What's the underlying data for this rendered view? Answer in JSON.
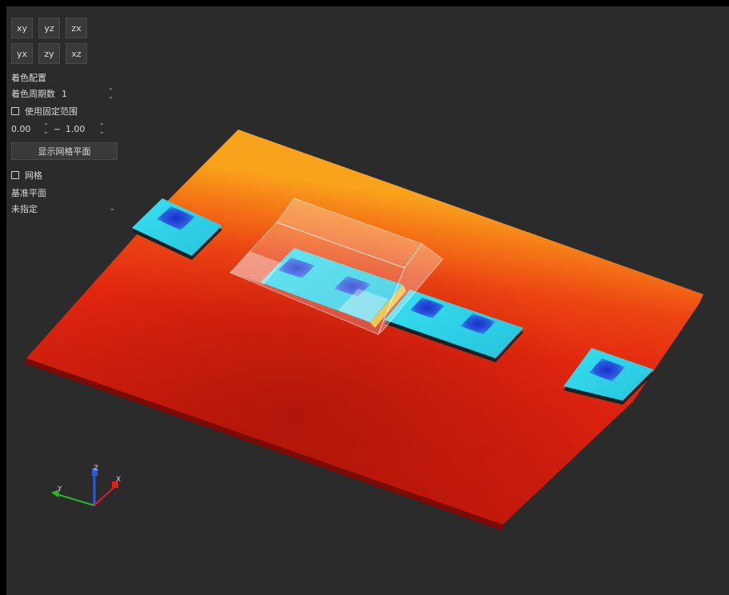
{
  "view_buttons": {
    "row1": [
      "xy",
      "yz",
      "zx"
    ],
    "row2": [
      "yx",
      "zy",
      "xz"
    ]
  },
  "color_config": {
    "title": "着色配置",
    "cycles_label": "着色周期数",
    "cycles_value": "1",
    "fixed_range_label": "使用固定范围",
    "range_min": "0.00",
    "range_sep": "~",
    "range_max": "1.00"
  },
  "grid_plane_button": "显示网格平面",
  "grid_checkbox_label": "网格",
  "base_plane": {
    "title": "基准平面",
    "selected": "未指定"
  },
  "axes": {
    "x": "X",
    "y": "Y",
    "z": "Z"
  },
  "icons": {
    "spin": "spin-arrows-icon",
    "dropdown": "chevron-down-icon"
  },
  "colors": {
    "background": "#2b2b2b",
    "heat_hot": "#d81e0f",
    "heat_warm": "#f7a21b",
    "pad_cyan": "#2fd7e8",
    "pad_core": "#1d44d8",
    "axis_x": "#e21f1f",
    "axis_y": "#26b82a",
    "axis_z": "#2a58e8"
  }
}
